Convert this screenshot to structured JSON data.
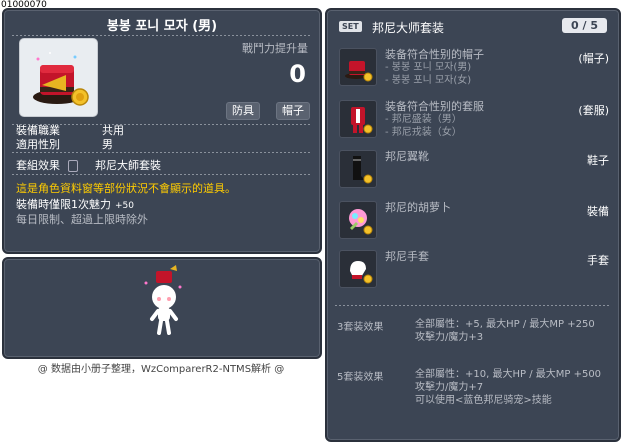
{
  "item_id": "01000070",
  "item": {
    "title": "봉봉 포니 모자 (男)",
    "power_label": "戰鬥力提升量",
    "power_value": "0",
    "tags": [
      "防具",
      "帽子"
    ],
    "job_label": "裝備職業",
    "job_value": "共用",
    "gender_label": "適用性別",
    "gender_value": "男",
    "set_label": "套組效果",
    "set_value": "邦尼大師套裝",
    "notice": "這是角色資料窗等部份狀況不會顯示的道具。",
    "limit": "裝備時僅限1次魅力",
    "limit_bonus": "+50",
    "limit2": "每日限制、超過上限時除外"
  },
  "footer": "@ 数据由小册子整理，WzComparerR2-NTMS解析 @",
  "set": {
    "badge": "SET",
    "name": "邦尼大师套装",
    "count": "0 / 5",
    "items": [
      {
        "name": "装备符合性别的帽子",
        "sub1": "- 봉봉 포니 모자(男)",
        "sub2": "- 봉봉 포니 모자(女)",
        "type": "(帽子)"
      },
      {
        "name": "装备符合性别的套服",
        "sub1": "- 邦尼盛装（男）",
        "sub2": "- 邦尼戎装（女）",
        "type": "(套服)"
      },
      {
        "name": "邦尼翼靴",
        "sub1": "",
        "sub2": "",
        "type": "鞋子"
      },
      {
        "name": "邦尼的胡萝卜",
        "sub1": "",
        "sub2": "",
        "type": "裝備"
      },
      {
        "name": "邦尼手套",
        "sub1": "",
        "sub2": "",
        "type": "手套"
      }
    ],
    "effects": [
      {
        "label": "3套装效果",
        "line1": "全部屬性：+5, 最大HP / 最大MP  +250",
        "line2": "攻擊力/魔力+3",
        "line3": ""
      },
      {
        "label": "5套装效果",
        "line1": "全部屬性：+10, 最大HP / 最大MP  +500",
        "line2": "攻擊力/魔力+7",
        "line3": "可以使用<蓝色邦尼骑宠>技能"
      }
    ]
  }
}
